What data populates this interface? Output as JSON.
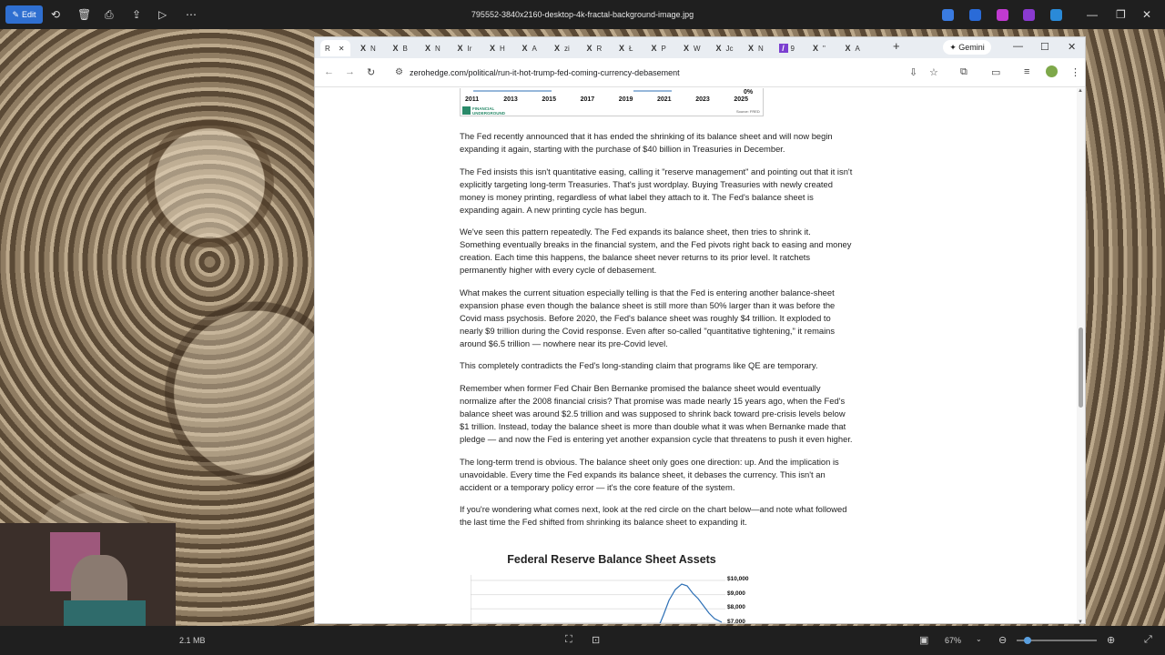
{
  "viewer": {
    "edit_label": "Edit",
    "file_title": "795552-3840x2160-desktop-4k-fractal-background-image.jpg",
    "file_size": "2.1 MB",
    "zoom": "67%"
  },
  "browser": {
    "active_tab": "R",
    "tabs": [
      {
        "icon": "X",
        "label": "N"
      },
      {
        "icon": "X",
        "label": "B"
      },
      {
        "icon": "X",
        "label": "N"
      },
      {
        "icon": "X",
        "label": "Ir"
      },
      {
        "icon": "X",
        "label": "H"
      },
      {
        "icon": "X",
        "label": "A"
      },
      {
        "icon": "X",
        "label": "zi"
      },
      {
        "icon": "X",
        "label": "R"
      },
      {
        "icon": "X",
        "label": "Ł"
      },
      {
        "icon": "X",
        "label": "P"
      },
      {
        "icon": "X",
        "label": "W"
      },
      {
        "icon": "X",
        "label": "Jc"
      },
      {
        "icon": "X",
        "label": "N"
      },
      {
        "icon": "/",
        "label": "9"
      },
      {
        "icon": "X",
        "label": "\""
      },
      {
        "icon": "X",
        "label": "A"
      }
    ],
    "gemini_label": "Gemini",
    "url": "zerohedge.com/political/run-it-hot-trump-fed-coming-currency-debasement"
  },
  "article": {
    "top_chart": {
      "years": [
        "2011",
        "2013",
        "2015",
        "2017",
        "2019",
        "2021",
        "2023",
        "2025"
      ],
      "pct": "0%",
      "brand": "FINANCIAL UNDERGROUND",
      "source": "Source: FRED"
    },
    "paragraphs": [
      "The Fed recently announced that it has ended the shrinking of its balance sheet and will now begin expanding it again, starting with the purchase of $40 billion in Treasuries in December.",
      "The Fed insists this isn't quantitative easing, calling it \"reserve management\" and pointing out that it isn't explicitly targeting long-term Treasuries. That's just wordplay. Buying Treasuries with newly created money is money printing, regardless of what label they attach to it. The Fed's balance sheet is expanding again. A new printing cycle has begun.",
      "We've seen this pattern repeatedly. The Fed expands its balance sheet, then tries to shrink it. Something eventually breaks in the financial system, and the Fed pivots right back to easing and money creation. Each time this happens, the balance sheet never returns to its prior level. It ratchets permanently higher with every cycle of debasement.",
      "What makes the current situation especially telling is that the Fed is entering another balance-sheet expansion phase even though the balance sheet is still more than 50% larger than it was before the Covid mass psychosis. Before 2020, the Fed's balance sheet was roughly $4 trillion. It exploded to nearly $9 trillion during the Covid response. Even after so-called \"quantitative tightening,\" it remains around $6.5 trillion — nowhere near its pre-Covid level.",
      "This completely contradicts the Fed's long-standing claim that programs like QE are temporary.",
      "Remember when former Fed Chair Ben Bernanke promised the balance sheet would eventually normalize after the 2008 financial crisis? That promise was made nearly 15 years ago, when the Fed's balance sheet was around $2.5 trillion and was supposed to shrink back toward pre-crisis levels below $1 trillion. Instead, today the balance sheet is more than double what it was when Bernanke made that pledge — and now the Fed is entering yet another expansion cycle that threatens to push it even higher.",
      "The long-term trend is obvious. The balance sheet only goes one direction: up. And the implication is unavoidable. Every time the Fed expands its balance sheet, it debases the currency. This isn't an accident or a temporary policy error — it's the core feature of the system.",
      "If you're wondering what comes next, look at the red circle on the chart below—and note what followed the last time the Fed shifted from shrinking its balance sheet to expanding it."
    ],
    "chart2": {
      "title": "Federal Reserve Balance Sheet Assets",
      "y_labels": [
        "$10,000",
        "$9,000",
        "$8,000",
        "$7,000"
      ]
    }
  },
  "chart_data": {
    "type": "line",
    "title": "Federal Reserve Balance Sheet Assets",
    "ylim": [
      7000,
      10000
    ],
    "y_ticks": [
      "$10,000",
      "$9,000",
      "$8,000",
      "$7,000"
    ]
  }
}
